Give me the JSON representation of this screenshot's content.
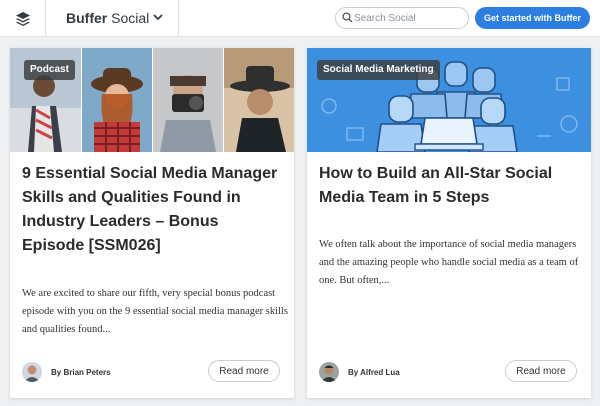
{
  "header": {
    "brand_strong": "Buffer",
    "brand_light": "Social",
    "search_placeholder": "Search Social",
    "cta_label": "Get started with Buffer",
    "accent_color": "#2c7ee0"
  },
  "cards": [
    {
      "badge": "Podcast",
      "title": "9 Essential Social Media Manager Skills and Qualities Found in Industry Leaders – Bonus Episode [SSM026]",
      "excerpt": "We are excited to share our fifth, very special bonus podcast episode with you on the 9 essential social media manager skills and qualities found...",
      "author": "By Brian Peters",
      "read_more": "Read more"
    },
    {
      "badge": "Social Media Marketing",
      "title": "How to Build an All-Star Social Media Team in 5 Steps",
      "excerpt": "We often talk about the importance of social media managers and the amazing people who handle social media as a team of one. But often,...",
      "author": "By Alfred Lua",
      "read_more": "Read more"
    }
  ],
  "icons": {
    "logo": "buffer-stack-icon",
    "dropdown": "chevron-down-icon",
    "search": "search-icon"
  }
}
